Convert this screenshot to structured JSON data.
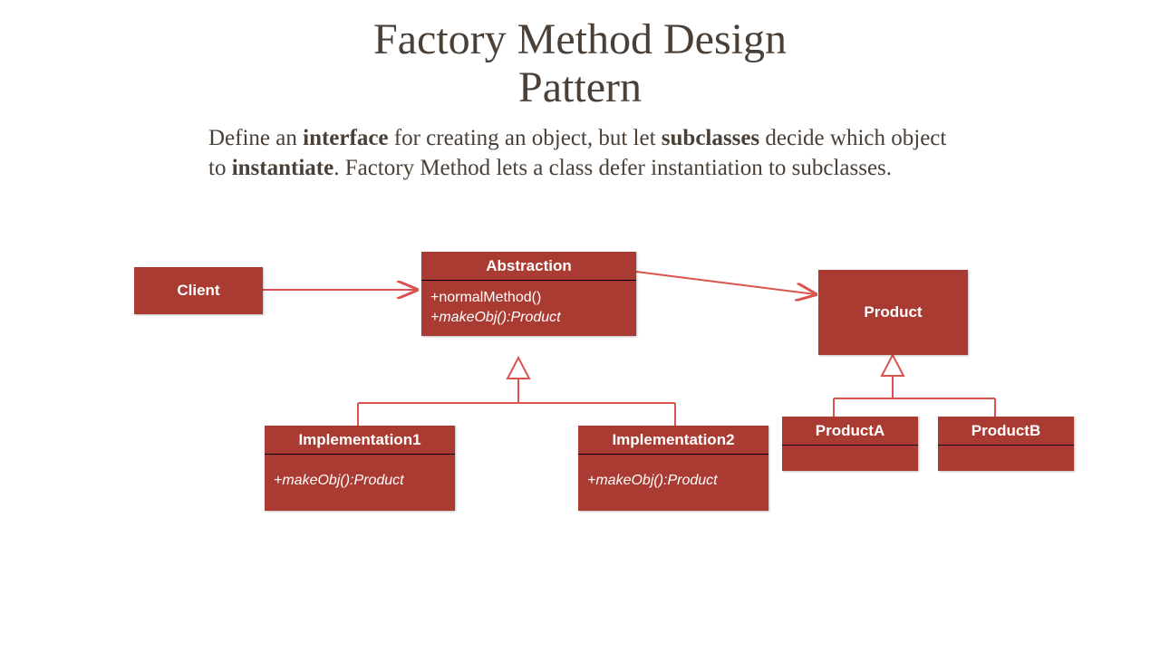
{
  "title_line1": "Factory Method Design",
  "title_line2": "Pattern",
  "description": {
    "t1": "Define an ",
    "b1": "interface",
    "t2": " for creating an object, but let ",
    "b2": "subclasses",
    "t3": " decide which object to ",
    "b3": "instantiate",
    "t4": ". Factory Method lets a class defer instantiation to subclasses."
  },
  "boxes": {
    "client": "Client",
    "abstraction": {
      "title": "Abstraction",
      "method1": "+normalMethod()",
      "method2": "+makeObj():Product"
    },
    "impl1": {
      "title": "Implementation1",
      "method": "+makeObj():Product"
    },
    "impl2": {
      "title": "Implementation2",
      "method": "+makeObj():Product"
    },
    "product": "Product",
    "productA": "ProductA",
    "productB": "ProductB"
  },
  "colors": {
    "box": "#aa3b32",
    "arrow": "#d9534f",
    "text": "#4a4038"
  }
}
